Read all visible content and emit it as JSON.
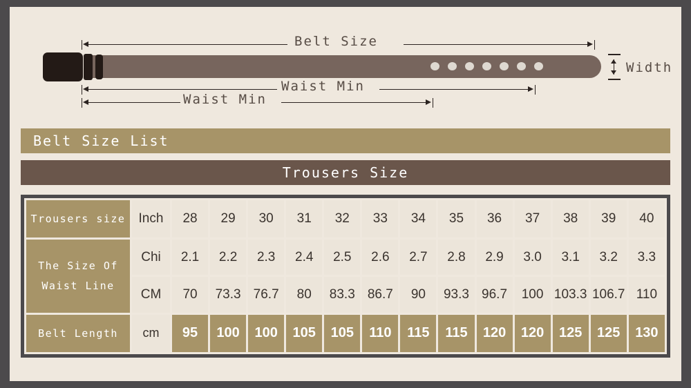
{
  "diagram": {
    "belt_size_label": "Belt Size",
    "waist_min_label_top": "Waist Min",
    "waist_min_label_bottom": "Waist Min",
    "width_label": "Width",
    "holes": 7,
    "colors": {
      "strap": "#77655d",
      "buckle": "#231a16",
      "hole": "#ded9d1",
      "background": "#efe8de",
      "frame": "#4c4a4c",
      "dimension_line": "#2b2320",
      "dimension_text": "#574c45"
    }
  },
  "bars": {
    "belt_size_list": "Belt Size List",
    "trousers_size": "Trousers Size",
    "colors": {
      "khaki": "#a79468",
      "brown": "#6a564b"
    }
  },
  "table": {
    "rows": [
      {
        "label": "Trousers size",
        "unit": "Inch",
        "style": "light",
        "values": [
          "28",
          "29",
          "30",
          "31",
          "32",
          "33",
          "34",
          "35",
          "36",
          "37",
          "38",
          "39",
          "40"
        ]
      },
      {
        "label": "The Size Of",
        "label2": "Waist Line",
        "unit": "Chi",
        "style": "light",
        "values": [
          "2.1",
          "2.2",
          "2.3",
          "2.4",
          "2.5",
          "2.6",
          "2.7",
          "2.8",
          "2.9",
          "3.0",
          "3.1",
          "3.2",
          "3.3"
        ]
      },
      {
        "unit": "CM",
        "style": "light",
        "values": [
          "70",
          "73.3",
          "76.7",
          "80",
          "83.3",
          "86.7",
          "90",
          "93.3",
          "96.7",
          "100",
          "103.3",
          "106.7",
          "110"
        ]
      },
      {
        "label": "Belt Length",
        "unit": "cm",
        "style": "khaki",
        "values": [
          "95",
          "100",
          "100",
          "105",
          "105",
          "110",
          "115",
          "115",
          "120",
          "120",
          "125",
          "125",
          "130"
        ]
      }
    ]
  }
}
